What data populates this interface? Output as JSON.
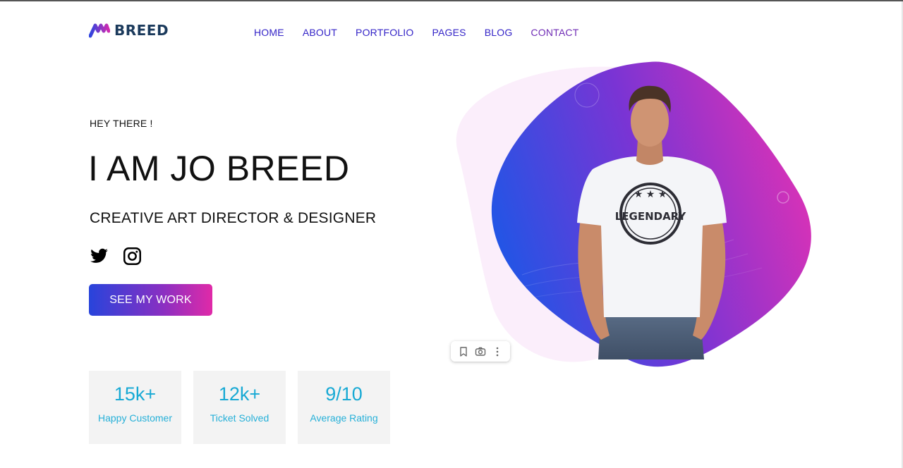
{
  "brand": {
    "name": "BREED",
    "logo_icon": "m-wave-logo-icon"
  },
  "nav": {
    "items": [
      {
        "label": "HOME"
      },
      {
        "label": "ABOUT"
      },
      {
        "label": "PORTFOLIO"
      },
      {
        "label": "PAGES"
      },
      {
        "label": "BLOG"
      },
      {
        "label": "CONTACT"
      }
    ]
  },
  "hero": {
    "eyebrow": "HEY THERE !",
    "title": "I AM JO BREED",
    "subtitle": "CREATIVE ART DIRECTOR & DESIGNER",
    "social": [
      {
        "icon": "twitter-icon"
      },
      {
        "icon": "instagram-icon"
      }
    ],
    "cta_label": "SEE MY WORK",
    "image": {
      "shirt_text": "LEGENDARY"
    }
  },
  "stats": [
    {
      "value": "15k+",
      "label": "Happy Customer"
    },
    {
      "value": "12k+",
      "label": "Ticket Solved"
    },
    {
      "value": "9/10",
      "label": "Average Rating"
    }
  ],
  "image_toolbar": {
    "icons": [
      "bookmark-icon",
      "camera-icon",
      "more-vertical-icon"
    ]
  },
  "colors": {
    "accent_blue": "#2844db",
    "accent_pink": "#e02aa8",
    "nav_text": "#3323c7",
    "stat_text": "#17a9d4",
    "brand_text": "#1b3a5c"
  }
}
